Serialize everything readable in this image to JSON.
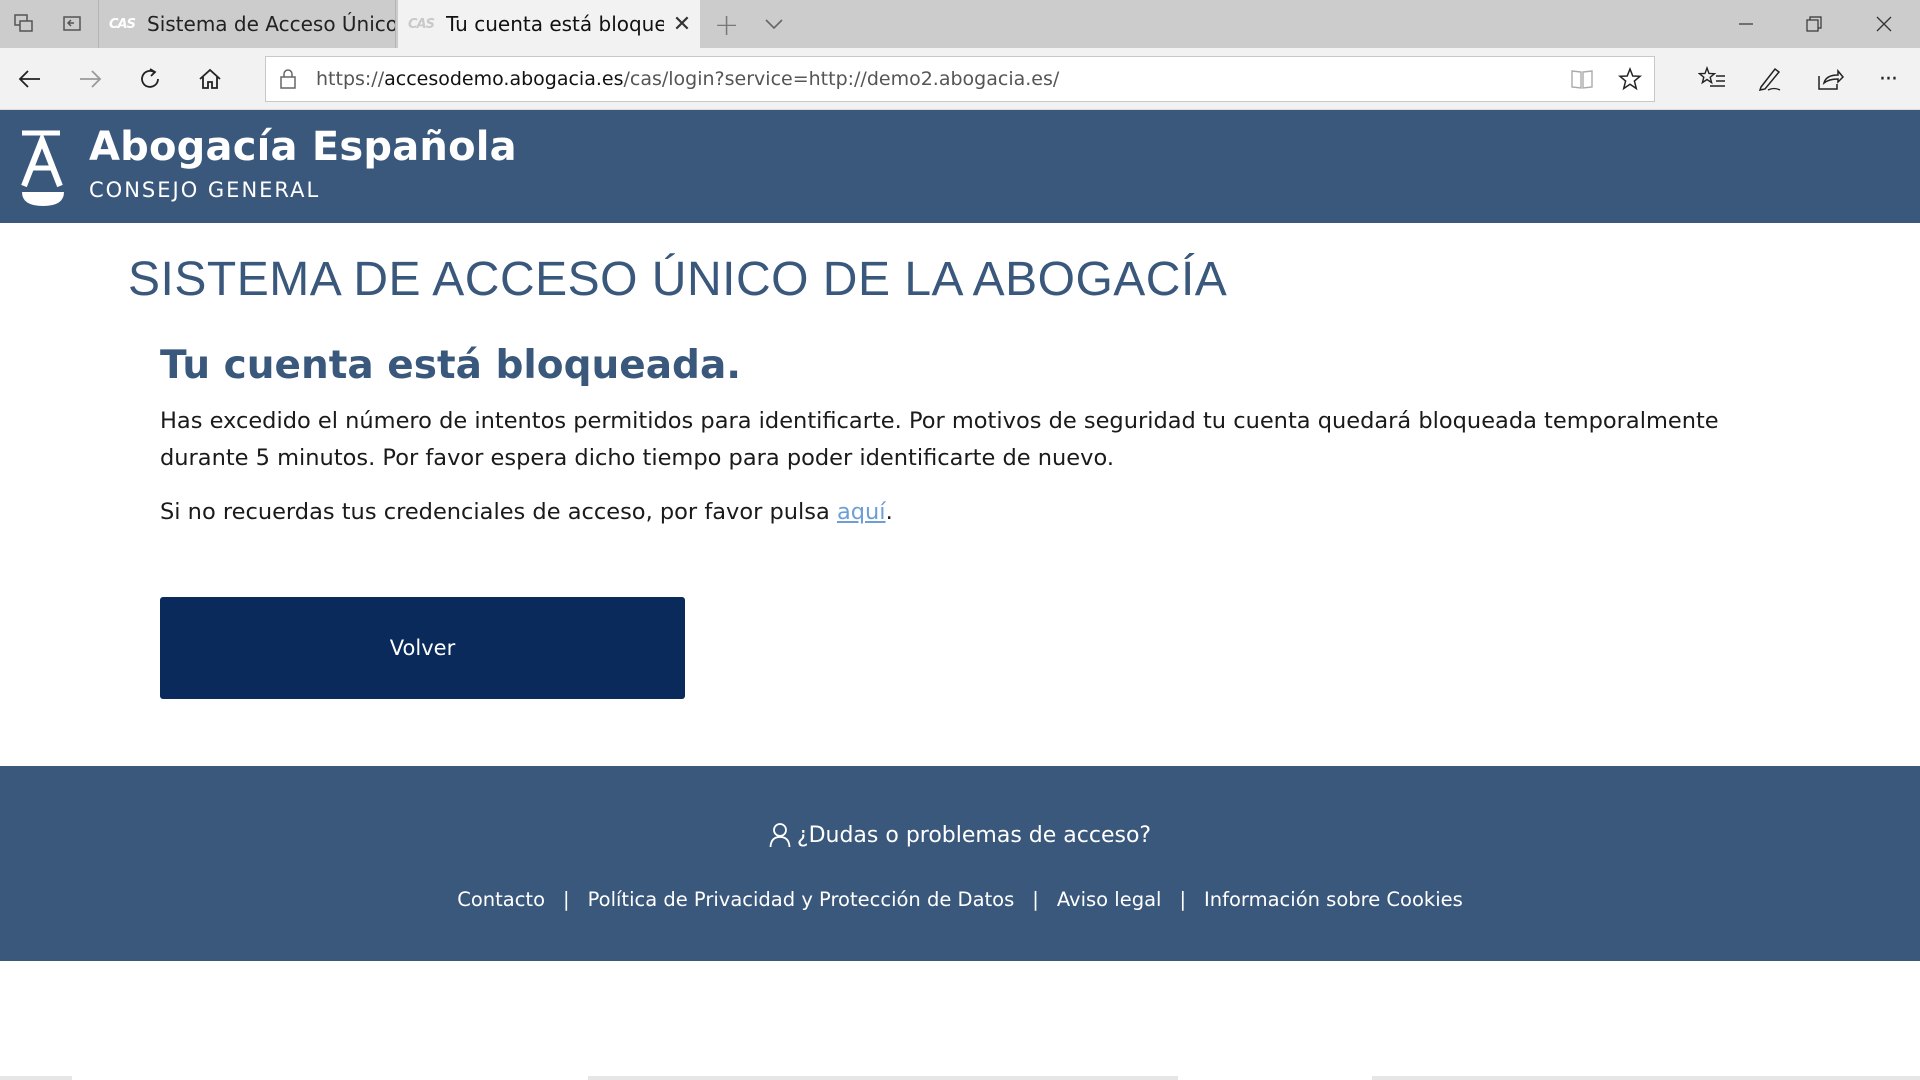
{
  "browser": {
    "tabs": [
      {
        "favicon": "CAS",
        "title": "Sistema de Acceso Único de"
      },
      {
        "favicon": "CAS",
        "title": "Tu cuenta está bloquea"
      }
    ],
    "url": {
      "scheme": "https://",
      "host": "accesodemo.abogacia.es",
      "path": "/cas/login?service=http://demo2.abogacia.es/"
    },
    "toolbar_overflow": "···"
  },
  "header": {
    "brand_name": "Abogacía Española",
    "brand_sub": "CONSEJO GENERAL"
  },
  "main": {
    "page_title": "SISTEMA DE ACCESO ÚNICO DE LA ABOGACÍA",
    "message_title": "Tu cuenta está bloqueada.",
    "message_body": "Has excedido el número de intentos permitidos para identificarte. Por motivos de seguridad tu cuenta quedará bloqueada temporalmente durante 5 minutos. Por favor espera dicho tiempo para poder identificarte de nuevo.",
    "help_prefix": "Si no recuerdas tus credenciales de acceso, por favor pulsa ",
    "help_link": "aquí",
    "help_suffix": ".",
    "back_button": "Volver"
  },
  "footer": {
    "help_text": "¿Dudas o problemas de acceso?",
    "links": [
      "Contacto",
      "Política de Privacidad y Protección de Datos",
      "Aviso legal",
      "Información sobre Cookies"
    ],
    "separator": "|"
  },
  "colors": {
    "brand_blue": "#3a587c",
    "button_navy": "#0a2a5c",
    "link_blue": "#6d9ed6"
  }
}
